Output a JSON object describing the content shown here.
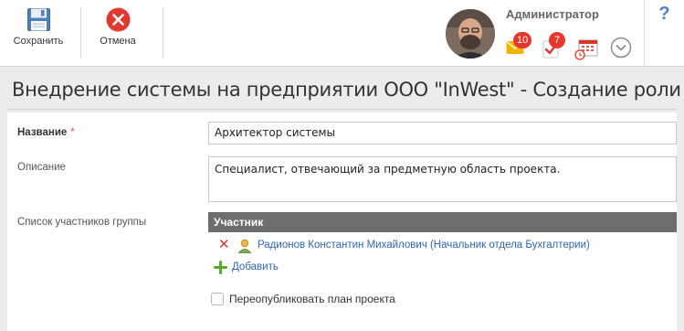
{
  "toolbar": {
    "save_label": "Сохранить",
    "cancel_label": "Отмена"
  },
  "user": {
    "name": "Администратор"
  },
  "notifications": {
    "messages_count": "10",
    "tasks_count": "7"
  },
  "help_label": "?",
  "page": {
    "title": "Внедрение системы на предприятии ООО \"InWest\" - Создание роли"
  },
  "form": {
    "name_label": "Название",
    "required_mark": "*",
    "name_value": "Архитектор системы",
    "description_label": "Описание",
    "description_value": "Специалист, отвечающий за предметную область проекта.",
    "members_label": "Список участников группы",
    "members_column": "Участник",
    "members": [
      {
        "name": "Радионов Константин Михайлович (Начальник отдела Бухгалтерии)"
      }
    ],
    "add_label": "Добавить",
    "republish_label": "Переопубликовать план проекта",
    "republish_checked": false
  },
  "colors": {
    "accent": "#2f66b3",
    "badge": "#e2382e",
    "cancel": "#e03a30",
    "grid_header": "#6e6e6e"
  },
  "icons": {
    "save": "floppy-disk-icon",
    "cancel": "close-circle-icon",
    "messages": "envelope-icon",
    "tasks": "task-check-icon",
    "calendar": "calendar-clock-icon",
    "more": "chevron-down-circle-icon",
    "member": "user-icon",
    "delete": "delete-x-icon",
    "add": "plus-icon"
  }
}
